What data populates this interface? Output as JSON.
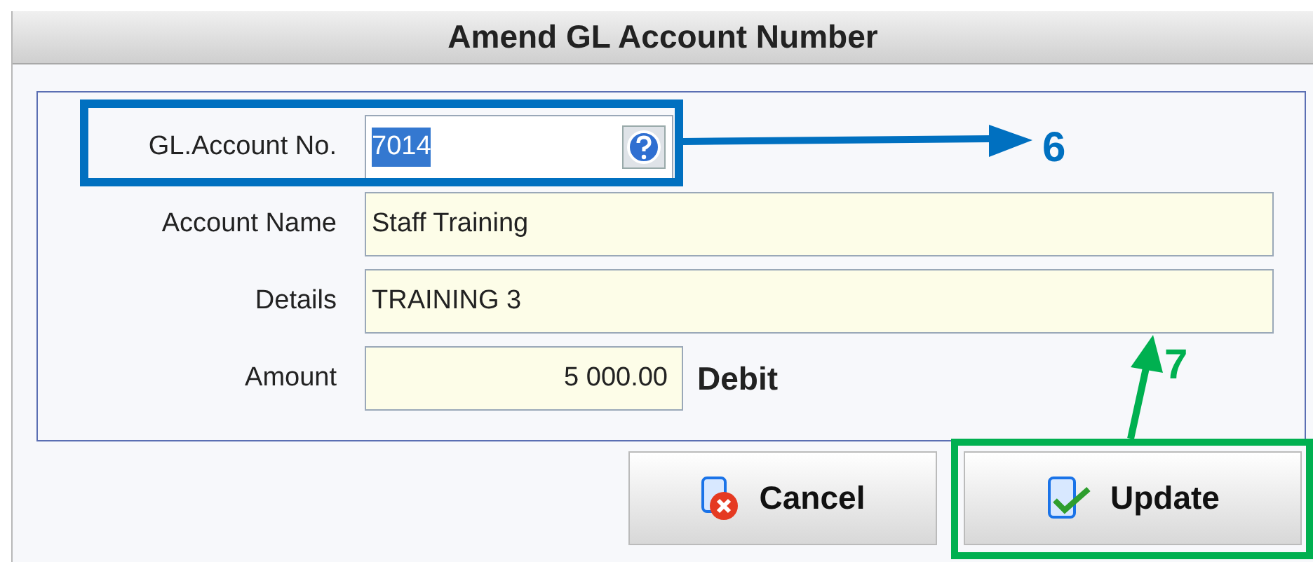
{
  "window": {
    "title": "Amend GL Account Number"
  },
  "fields": [
    {
      "label": "GL.Account No.",
      "value": "7014",
      "kind": "lookup",
      "text_selected": true
    },
    {
      "label": "Account Name",
      "value": "Staff Training",
      "kind": "text"
    },
    {
      "label": "Details",
      "value": "TRAINING 3",
      "kind": "text"
    },
    {
      "label": "Amount",
      "value": "5 000.00",
      "kind": "amount",
      "suffix": "Debit"
    }
  ],
  "buttons": [
    {
      "label": "Cancel",
      "kind": "cancel"
    },
    {
      "label": "Update",
      "kind": "update"
    }
  ],
  "annotations": [
    {
      "label": "6",
      "color": "#0070c0"
    },
    {
      "label": "7",
      "color": "#00b050"
    }
  ]
}
